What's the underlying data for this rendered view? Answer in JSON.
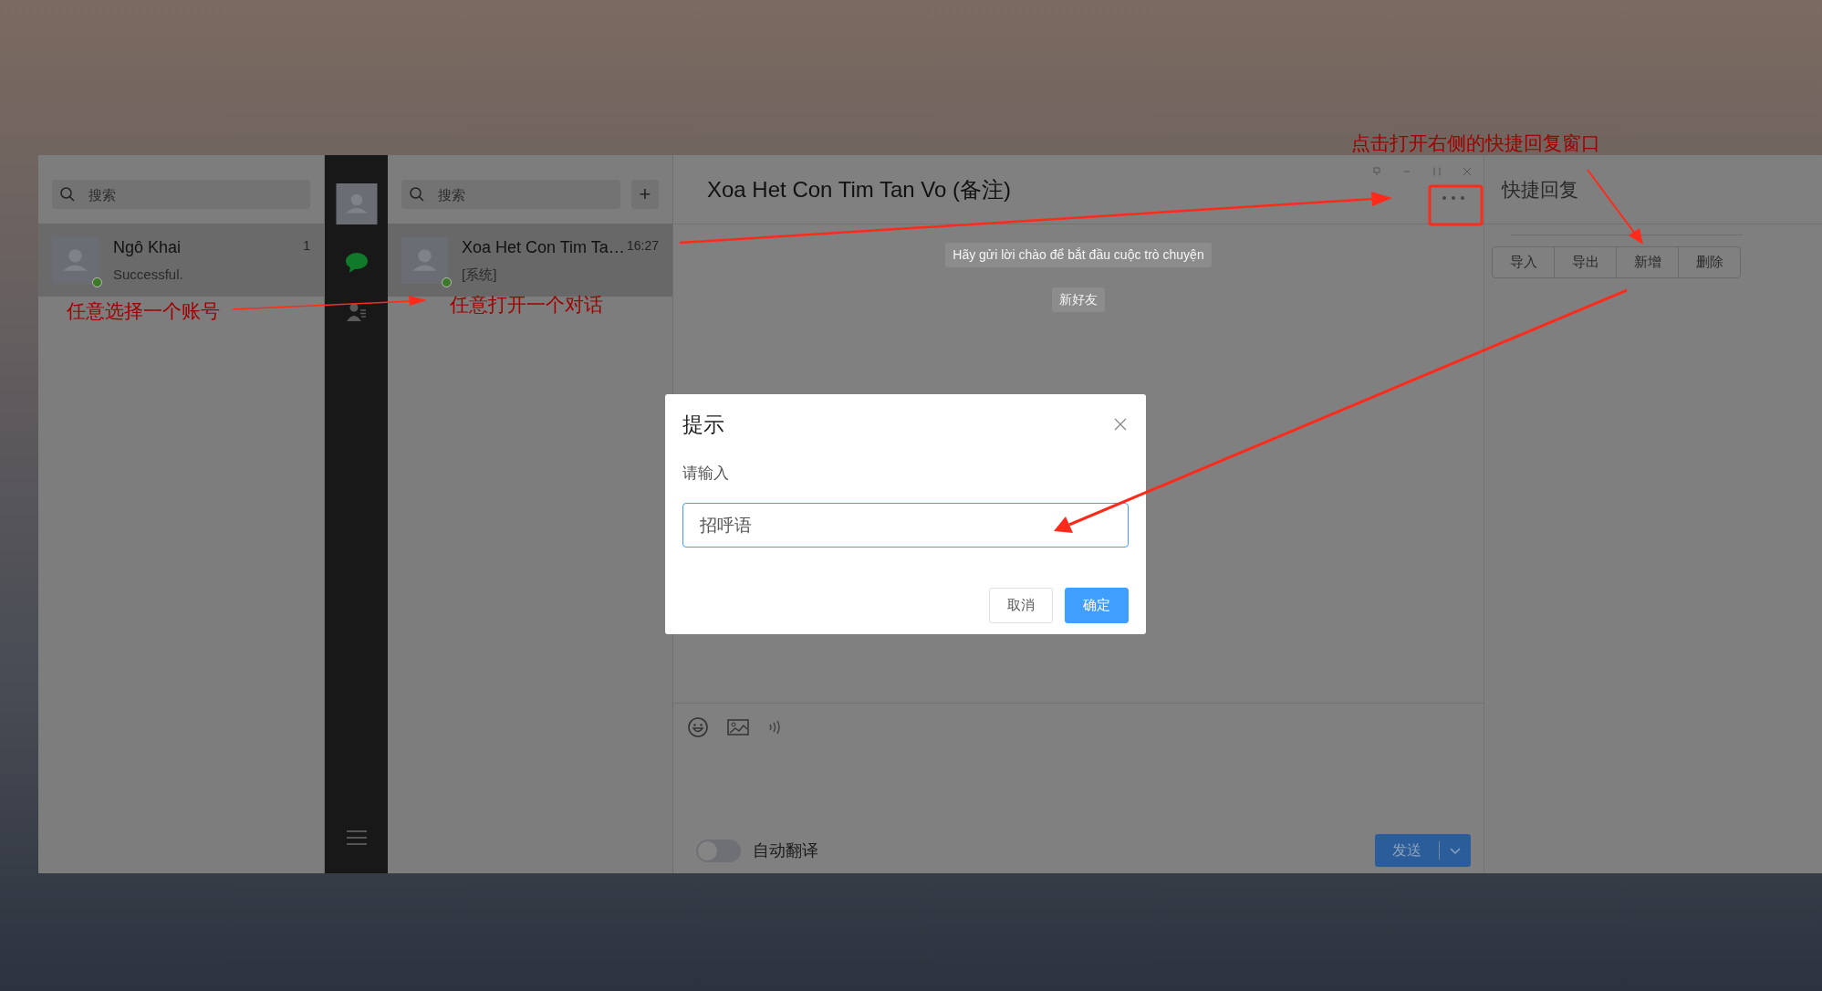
{
  "accounts_panel": {
    "search": {
      "placeholder": "搜索"
    },
    "accounts": [
      {
        "name": "Ngô Khai",
        "status": "Successful.",
        "badge": "1",
        "online": true,
        "selected": true
      }
    ]
  },
  "nav": {
    "items": [
      {
        "kind": "chat",
        "selected": true
      },
      {
        "kind": "contacts",
        "selected": false
      }
    ]
  },
  "conversations_panel": {
    "search": {
      "placeholder": "搜索"
    },
    "add_button": "+",
    "conversations": [
      {
        "name": "Xoa Het Con Tim Ta…",
        "time": "16:27",
        "preview": "[系统]",
        "online": true,
        "selected": true
      }
    ]
  },
  "chat": {
    "title": "Xoa Het Con Tim Tan Vo (备注)",
    "messages": [
      {
        "kind": "notice",
        "text": "Hãy gửi lời chào để bắt đầu cuộc trò chuyện"
      },
      {
        "kind": "notice",
        "text": "新好友"
      }
    ],
    "auto_translate": {
      "label": "自动翻译",
      "on": false
    },
    "send_button": "发送"
  },
  "quick_reply": {
    "title": "快捷回复",
    "buttons": [
      "导入",
      "导出",
      "新增",
      "删除"
    ]
  },
  "dialog": {
    "title": "提示",
    "label": "请输入",
    "value": "招呼语",
    "buttons": [
      {
        "label": "取消",
        "kind": "secondary"
      },
      {
        "label": "确定",
        "kind": "primary"
      }
    ]
  },
  "annotations": [
    {
      "text": "任意选择一个账号"
    },
    {
      "text": "任意打开一个对话"
    },
    {
      "text": "点击打开右侧的快捷回复窗口"
    }
  ]
}
